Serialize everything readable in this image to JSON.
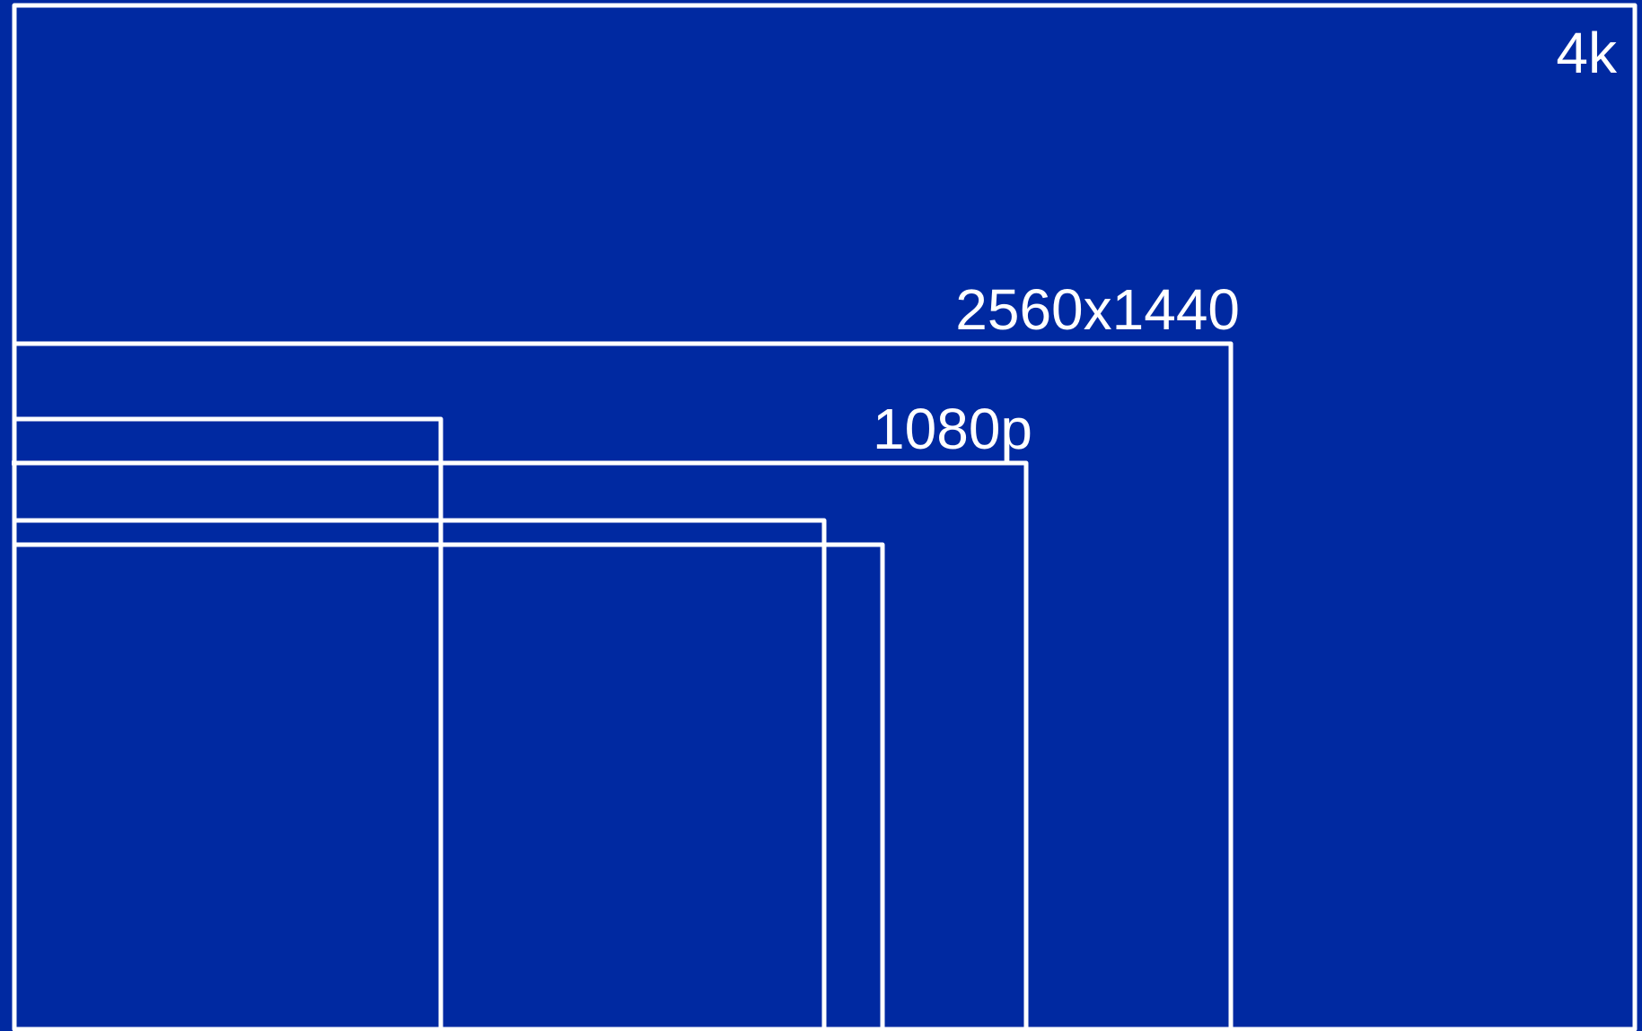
{
  "diagram": {
    "background_color": "#0029a1",
    "line_color": "#ffffff",
    "labels": {
      "uhd_4k": "4k",
      "qhd": "2560x1440",
      "full_hd": "1080p"
    }
  }
}
